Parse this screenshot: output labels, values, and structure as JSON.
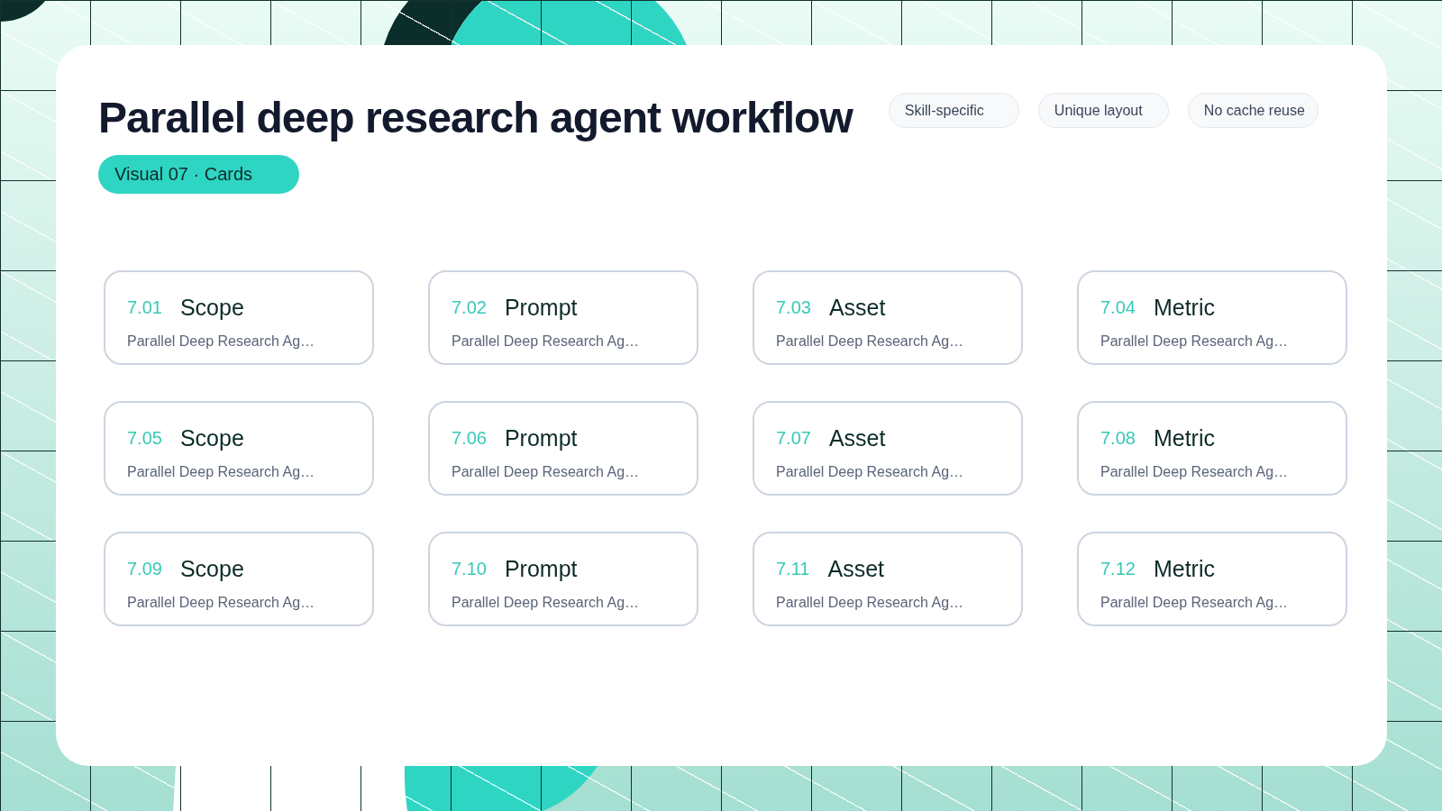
{
  "title": "Parallel deep research agent workflow",
  "tag": "Visual 07 · Cards",
  "chips": [
    "Skill-specific",
    "Unique layout",
    "No cache reuse"
  ],
  "cards": [
    {
      "number": "7.01",
      "title": "Scope",
      "description": "Parallel Deep Research Ag…"
    },
    {
      "number": "7.02",
      "title": "Prompt",
      "description": "Parallel Deep Research Ag…"
    },
    {
      "number": "7.03",
      "title": "Asset",
      "description": "Parallel Deep Research Ag…"
    },
    {
      "number": "7.04",
      "title": "Metric",
      "description": "Parallel Deep Research Ag…"
    },
    {
      "number": "7.05",
      "title": "Scope",
      "description": "Parallel Deep Research Ag…"
    },
    {
      "number": "7.06",
      "title": "Prompt",
      "description": "Parallel Deep Research Ag…"
    },
    {
      "number": "7.07",
      "title": "Asset",
      "description": "Parallel Deep Research Ag…"
    },
    {
      "number": "7.08",
      "title": "Metric",
      "description": "Parallel Deep Research Ag…"
    },
    {
      "number": "7.09",
      "title": "Scope",
      "description": "Parallel Deep Research Ag…"
    },
    {
      "number": "7.10",
      "title": "Prompt",
      "description": "Parallel Deep Research Ag…"
    },
    {
      "number": "7.11",
      "title": "Asset",
      "description": "Parallel Deep Research Ag…"
    },
    {
      "number": "7.12",
      "title": "Metric",
      "description": "Parallel Deep Research Ag…"
    }
  ]
}
